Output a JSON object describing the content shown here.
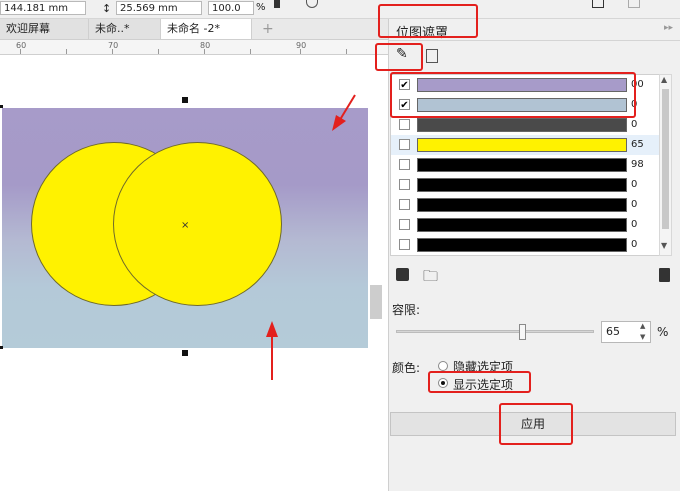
{
  "toolbar": {
    "x_value": "144.181 mm",
    "height_value": "25.569 mm",
    "scale_value": "100.0",
    "percent_label": "%"
  },
  "tabs": [
    {
      "label": "欢迎屏幕"
    },
    {
      "label": "未命..*"
    },
    {
      "label": "未命名 -2*"
    },
    {
      "label": "+"
    }
  ],
  "ruler": {
    "labels": [
      "60",
      "70",
      "80",
      "90"
    ]
  },
  "docker": {
    "title": "位图遮罩",
    "colors": [
      {
        "checked": true,
        "color": "#a79bc9",
        "value": "00"
      },
      {
        "checked": true,
        "color": "#b1c3d3",
        "value": "0"
      },
      {
        "checked": false,
        "color": "#4a4a4a",
        "value": "0"
      },
      {
        "checked": false,
        "color": "#fff200",
        "value": "65"
      },
      {
        "checked": false,
        "color": "#000000",
        "value": "98"
      },
      {
        "checked": false,
        "color": "#000000",
        "value": "0"
      },
      {
        "checked": false,
        "color": "#000000",
        "value": "0"
      },
      {
        "checked": false,
        "color": "#000000",
        "value": "0"
      },
      {
        "checked": false,
        "color": "#000000",
        "value": "0"
      }
    ],
    "tolerance_label": "容限:",
    "tolerance_value": "65",
    "tolerance_unit": "%",
    "tolerance_fraction": 0.65,
    "color_label": "颜色:",
    "radio_hide": "隐藏选定项",
    "radio_show": "显示选定项",
    "radio_selected": "show",
    "apply_label": "应用"
  },
  "annotation_color": "#e3201d"
}
